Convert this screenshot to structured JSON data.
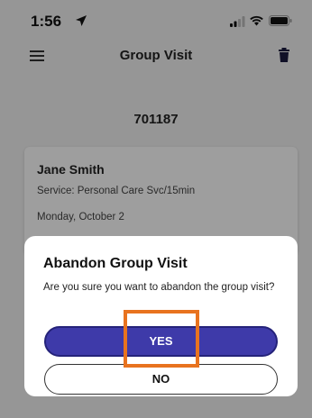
{
  "status_bar": {
    "time": "1:56"
  },
  "nav": {
    "title": "Group Visit"
  },
  "visit": {
    "id": "701187",
    "client_name": "Jane Smith",
    "service": "Service: Personal Care Svc/15min",
    "date": "Monday, October 2"
  },
  "dialog": {
    "title": "Abandon Group Visit",
    "message": "Are you sure you want to abandon the group visit?",
    "yes_label": "YES",
    "no_label": "NO"
  },
  "colors": {
    "primary": "#3e3aa9",
    "highlight": "#e8731f"
  }
}
